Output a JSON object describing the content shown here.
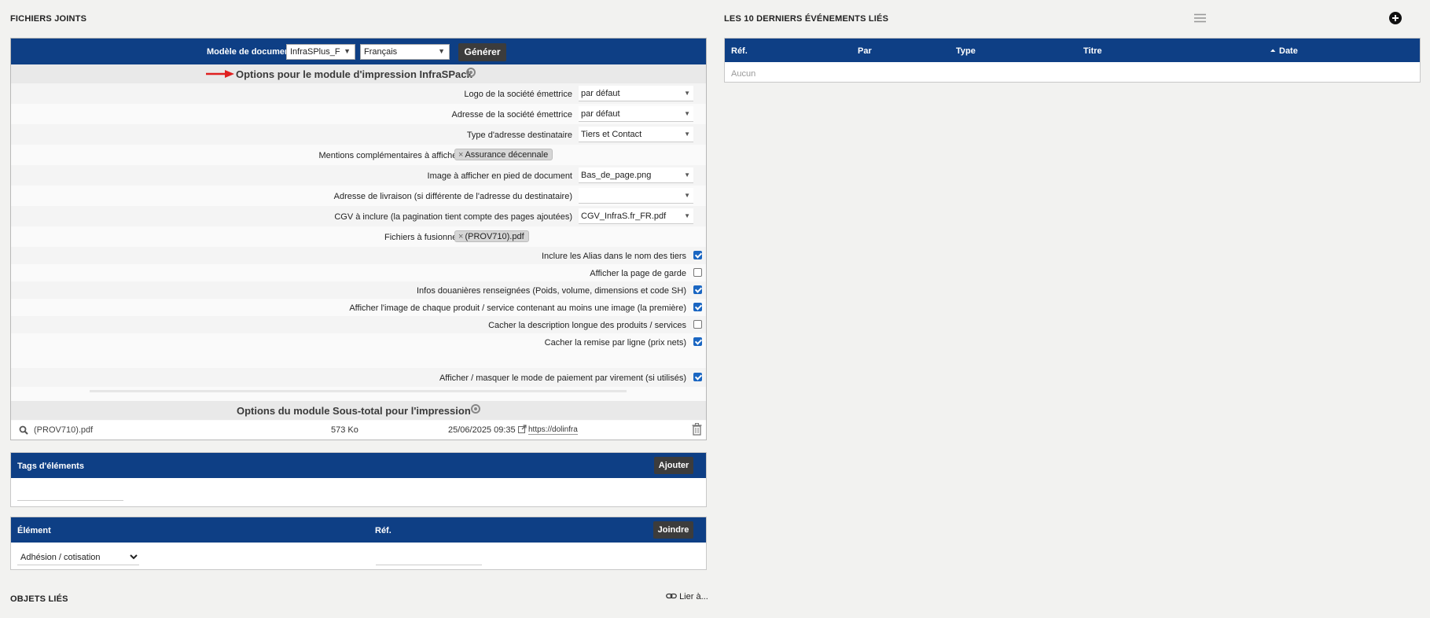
{
  "left": {
    "section_title": "FICHIERS JOINTS",
    "generator": {
      "label": "Modèle de document",
      "model_value": "InfraSPlus_F",
      "language_value": "Français",
      "generate_button": "Générer"
    },
    "options_header_1": "Options pour le module d'impression InfraSPack",
    "rows": [
      {
        "label": "Logo de la société émettrice",
        "value": "par défaut"
      },
      {
        "label": "Adresse de la société émettrice",
        "value": "par défaut"
      },
      {
        "label": "Type d'adresse destinataire",
        "value": "Tiers et Contact"
      },
      {
        "label": "Mentions complémentaires à afficher",
        "tag": "Assurance décennale"
      },
      {
        "label": "Image à afficher en pied de document",
        "value": "Bas_de_page.png"
      },
      {
        "label": "Adresse de livraison (si différente de l'adresse du destinataire)",
        "value": ""
      },
      {
        "label": "CGV à inclure (la pagination tient compte des pages ajoutées)",
        "value": "CGV_InfraS.fr_FR.pdf"
      },
      {
        "label": "Fichiers à fusionner",
        "tag": "(PROV710).pdf"
      }
    ],
    "checkboxes": [
      {
        "label": "Inclure les Alias dans le nom des tiers",
        "checked": true
      },
      {
        "label": "Afficher la page de garde",
        "checked": false
      },
      {
        "label": "Infos douanières renseignées (Poids, volume, dimensions et code SH)",
        "checked": true
      },
      {
        "label": "Afficher l'image de chaque produit / service contenant au moins une image (la première)",
        "checked": true
      },
      {
        "label": "Cacher la description longue des produits / services",
        "checked": false
      },
      {
        "label": "Cacher la remise par ligne (prix nets)",
        "checked": true
      },
      {
        "label": "Afficher / masquer le mode de paiement par virement (si utilisés)",
        "checked": true
      }
    ],
    "options_header_2": "Options du module Sous-total pour l'impression",
    "file": {
      "name": "(PROV710).pdf",
      "size": "573 Ko",
      "date": "25/06/2025 09:35",
      "link": "https://dolinfras"
    },
    "tags_panel": {
      "title": "Tags d'éléments",
      "add_button": "Ajouter"
    },
    "element_panel": {
      "col_element": "Élément",
      "col_ref": "Réf.",
      "join_button": "Joindre",
      "select_value": "Adhésion / cotisation"
    },
    "linked_title": "OBJETS LIÉS",
    "link_action": "Lier à..."
  },
  "right": {
    "section_title": "LES 10 DERNIERS ÉVÉNEMENTS LIÉS",
    "columns": [
      "Réf.",
      "Par",
      "Type",
      "Titre",
      "Date"
    ],
    "sort_indicator": "⏶",
    "empty_text": "Aucun"
  },
  "colors": {
    "header_blue": "#0e3f85",
    "button_dark": "#3c3c3c",
    "arrow_red": "#e02020",
    "check_blue": "#1a66c2"
  }
}
